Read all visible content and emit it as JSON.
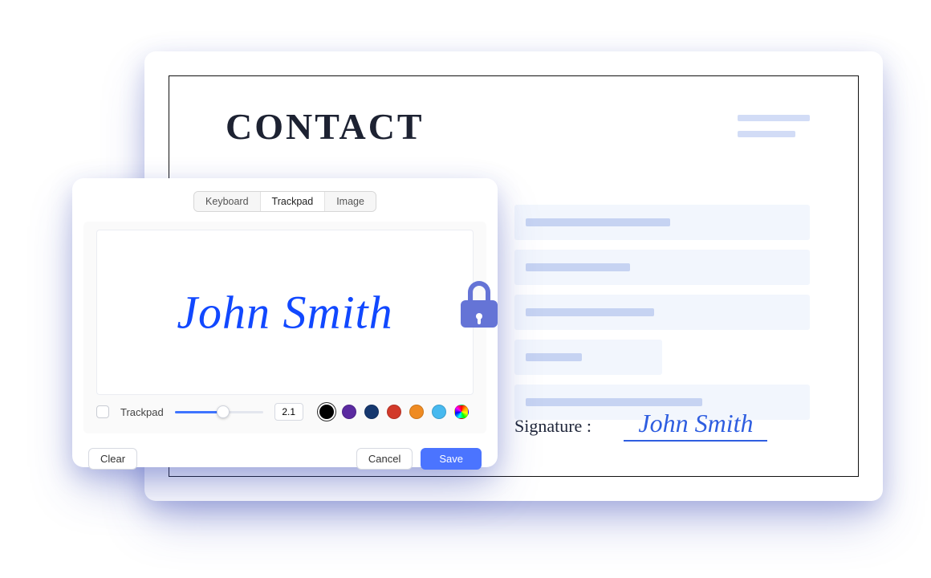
{
  "document": {
    "title": "CONTACT",
    "signature_label": "Signature :",
    "signature_value": "John Smith"
  },
  "panel": {
    "tabs": [
      "Keyboard",
      "Trackpad",
      "Image"
    ],
    "active_tab_index": 1,
    "signature_text": "John Smith",
    "trackpad_checkbox_label": "Trackpad",
    "stroke_size": "2.1",
    "colors": [
      "#000000",
      "#5b2aa0",
      "#16386f",
      "#d23a2a",
      "#ef8b22",
      "#47b9ef",
      "rainbow"
    ],
    "selected_color_index": 0,
    "buttons": {
      "clear": "Clear",
      "cancel": "Cancel",
      "save": "Save"
    }
  }
}
